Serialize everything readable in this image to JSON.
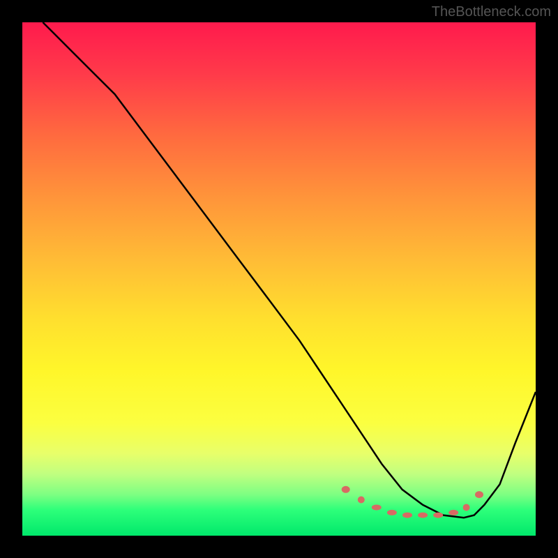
{
  "watermark": "TheBottleneck.com",
  "chart_data": {
    "type": "line",
    "title": "",
    "xlabel": "",
    "ylabel": "",
    "xlim": [
      0,
      100
    ],
    "ylim": [
      0,
      100
    ],
    "grid": false,
    "legend": false,
    "background": "rainbow-gradient",
    "series": [
      {
        "name": "curve",
        "x": [
          4,
          6,
          10,
          14,
          18,
          24,
          30,
          36,
          42,
          48,
          54,
          58,
          62,
          66,
          70,
          74,
          78,
          82,
          86,
          88,
          90,
          93,
          96,
          100
        ],
        "y": [
          100,
          98,
          94,
          90,
          86,
          78,
          70,
          62,
          54,
          46,
          38,
          32,
          26,
          20,
          14,
          9,
          6,
          4,
          3.5,
          4,
          6,
          10,
          18,
          28
        ]
      }
    ],
    "markers": [
      {
        "x": 63,
        "y": 9,
        "rx": 6,
        "ry": 5
      },
      {
        "x": 66,
        "y": 7,
        "rx": 5,
        "ry": 5
      },
      {
        "x": 69,
        "y": 5.5,
        "rx": 7,
        "ry": 4
      },
      {
        "x": 72,
        "y": 4.5,
        "rx": 7,
        "ry": 4
      },
      {
        "x": 75,
        "y": 4,
        "rx": 7,
        "ry": 4
      },
      {
        "x": 78,
        "y": 4,
        "rx": 7,
        "ry": 4
      },
      {
        "x": 81,
        "y": 4,
        "rx": 7,
        "ry": 4
      },
      {
        "x": 84,
        "y": 4.5,
        "rx": 7,
        "ry": 4
      },
      {
        "x": 86.5,
        "y": 5.5,
        "rx": 5,
        "ry": 5
      },
      {
        "x": 89,
        "y": 8,
        "rx": 6,
        "ry": 5
      }
    ]
  }
}
